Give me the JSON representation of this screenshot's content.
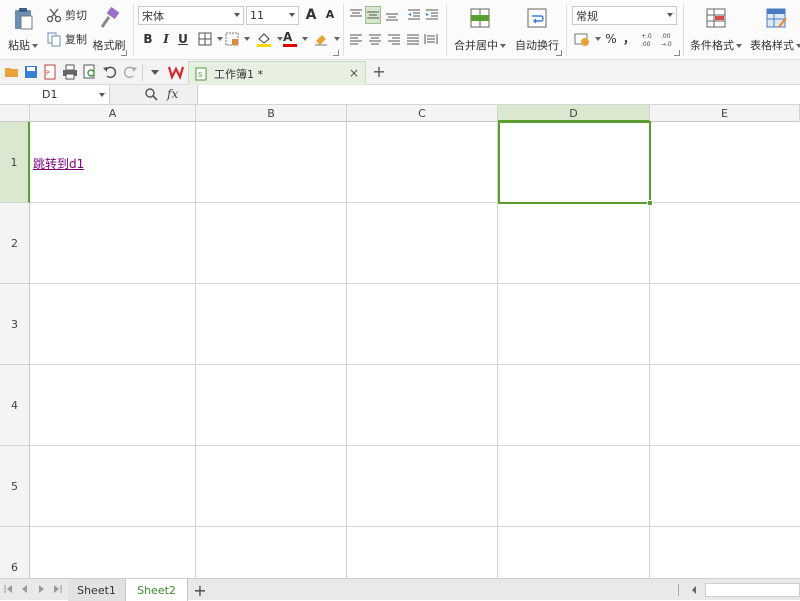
{
  "ribbon": {
    "paste": "粘贴",
    "cut": "剪切",
    "copy": "复制",
    "format_painter": "格式刷",
    "font_name": "宋体",
    "font_size": "11",
    "merge_center": "合并居中",
    "wrap_text": "自动换行",
    "number_format": "常规",
    "percent": "%",
    "comma": "，",
    "increase_decimal": ".00→.0",
    "conditional_format": "条件格式",
    "table_style": "表格样式",
    "bold": "B",
    "italic": "I",
    "underline": "U",
    "grow_font": "A",
    "shrink_font": "A",
    "font_color_glyph": "A"
  },
  "colors": {
    "accent_green": "#5a9e2f",
    "selected_header": "#dbe8d0",
    "hyperlink": "#800080",
    "font_color_bar": "#e00000",
    "fill_color_bar": "#ffd700"
  },
  "quickbar": {
    "document_tab": "工作簿1 *"
  },
  "formula_bar": {
    "name_box": "D1",
    "fx": "fx",
    "content": ""
  },
  "grid": {
    "columns": [
      "A",
      "B",
      "C",
      "D",
      "E"
    ],
    "rows": [
      "1",
      "2",
      "3",
      "4",
      "5",
      "6"
    ],
    "cells": {
      "A1": "跳转到d1"
    },
    "selected_cell": "D1"
  },
  "sheets": {
    "tabs": [
      "Sheet1",
      "Sheet2"
    ],
    "active": "Sheet2"
  }
}
